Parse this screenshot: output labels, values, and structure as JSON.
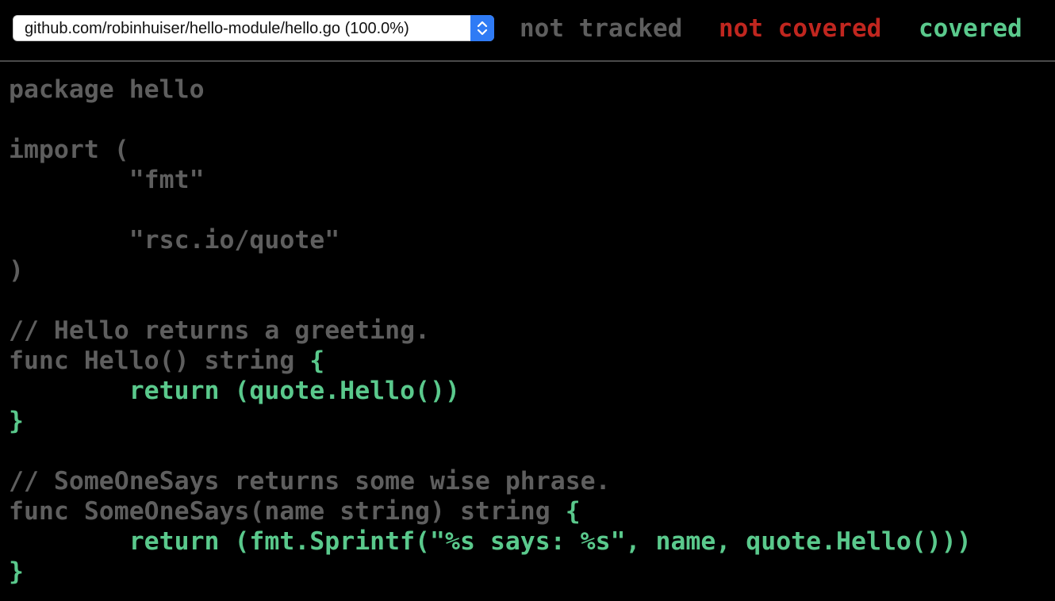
{
  "header": {
    "file_select_label": "github.com/robinhuiser/hello-module/hello.go (100.0%)",
    "legend": {
      "not_tracked": "not tracked",
      "not_covered": "not covered",
      "covered": "covered"
    }
  },
  "colors": {
    "background": "#000000",
    "not_tracked": "#5e5e5e",
    "not_covered": "#c0261f",
    "covered": "#5ac98c",
    "select_accent": "#2f7bf5"
  },
  "code": {
    "lines": [
      [
        {
          "t": "package hello",
          "s": "nt"
        }
      ],
      [],
      [
        {
          "t": "import (",
          "s": "nt"
        }
      ],
      [
        {
          "t": "        \"fmt\"",
          "s": "nt"
        }
      ],
      [],
      [
        {
          "t": "        \"rsc.io/quote\"",
          "s": "nt"
        }
      ],
      [
        {
          "t": ")",
          "s": "nt"
        }
      ],
      [],
      [
        {
          "t": "// Hello returns a greeting.",
          "s": "nt"
        }
      ],
      [
        {
          "t": "func Hello() string ",
          "s": "nt"
        },
        {
          "t": "{",
          "s": "cov"
        }
      ],
      [
        {
          "t": "        ",
          "s": "nt"
        },
        {
          "t": "return (quote.Hello())",
          "s": "cov"
        }
      ],
      [
        {
          "t": "}",
          "s": "cov"
        }
      ],
      [],
      [
        {
          "t": "// SomeOneSays returns some wise phrase.",
          "s": "nt"
        }
      ],
      [
        {
          "t": "func SomeOneSays(name string) string ",
          "s": "nt"
        },
        {
          "t": "{",
          "s": "cov"
        }
      ],
      [
        {
          "t": "        ",
          "s": "nt"
        },
        {
          "t": "return (fmt.Sprintf(\"%s says: %s\", name, quote.Hello()))",
          "s": "cov"
        }
      ],
      [
        {
          "t": "}",
          "s": "cov"
        }
      ]
    ]
  }
}
